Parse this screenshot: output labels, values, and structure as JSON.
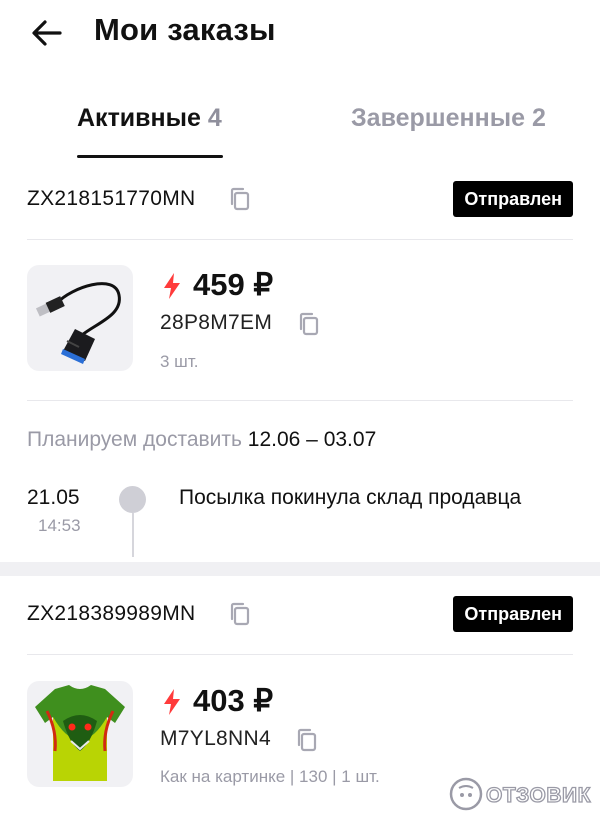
{
  "header": {
    "title": "Мои заказы",
    "back_icon": "arrow-left-icon"
  },
  "tabs": [
    {
      "label": "Активные",
      "count": "4",
      "active": true
    },
    {
      "label": "Завершенные",
      "count": "2",
      "active": false
    }
  ],
  "orders": [
    {
      "order_number": "ZX218151770MN",
      "status": "Отправлен",
      "item": {
        "price": "459 ₽",
        "sku": "28P8M7EM",
        "meta": "3 шт.",
        "image": "usb-sata-adapter-cable"
      },
      "delivery": {
        "label": "Планируем доставить",
        "dates": "12.06 – 03.07"
      },
      "tracking": [
        {
          "date": "21.05",
          "time": "14:53",
          "text": "Посылка покинула склад продавца"
        }
      ]
    },
    {
      "order_number": "ZX218389989MN",
      "status": "Отправлен",
      "item": {
        "price": "403 ₽",
        "sku": "M7YL8NN4",
        "meta": "Как на картинке | 130 | 1 шт.",
        "image": "dragon-print-tshirt"
      }
    }
  ],
  "icons": {
    "copy": "copy-icon",
    "bolt": "lightning-bolt-icon"
  },
  "colors": {
    "accent": "#ff3b3b",
    "status_badge_bg": "#000000",
    "muted_text": "#9a9aa6",
    "divider": "#e8e8ec",
    "section_gap": "#f0f0f3"
  },
  "watermark": {
    "text": "ОТЗОВИК"
  }
}
